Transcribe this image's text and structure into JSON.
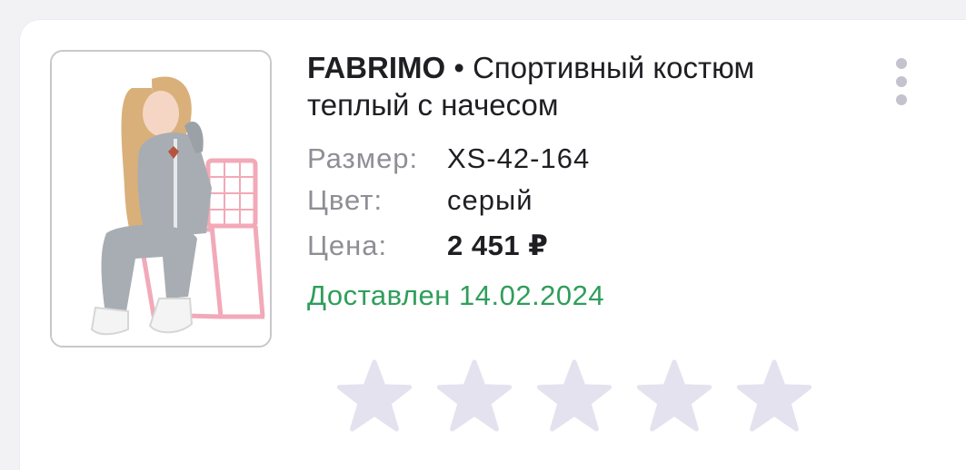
{
  "product": {
    "brand": "FABRIMO",
    "separator": " • ",
    "name": "Спортивный костюм теплый с начесом",
    "image_alt": "product-photo"
  },
  "details": [
    {
      "label": "Размер:",
      "value": "XS-42-164"
    },
    {
      "label": "Цвет:",
      "value": "серый"
    },
    {
      "label": "Цена:",
      "value": "2 451 ₽"
    }
  ],
  "status": {
    "text": "Доставлен 14.02.2024",
    "color": "#2f9e5a"
  },
  "rating": {
    "max": 5,
    "value": 0,
    "empty_color": "#e3e2ee"
  },
  "menu": {
    "icon": "more-vertical-icon"
  }
}
